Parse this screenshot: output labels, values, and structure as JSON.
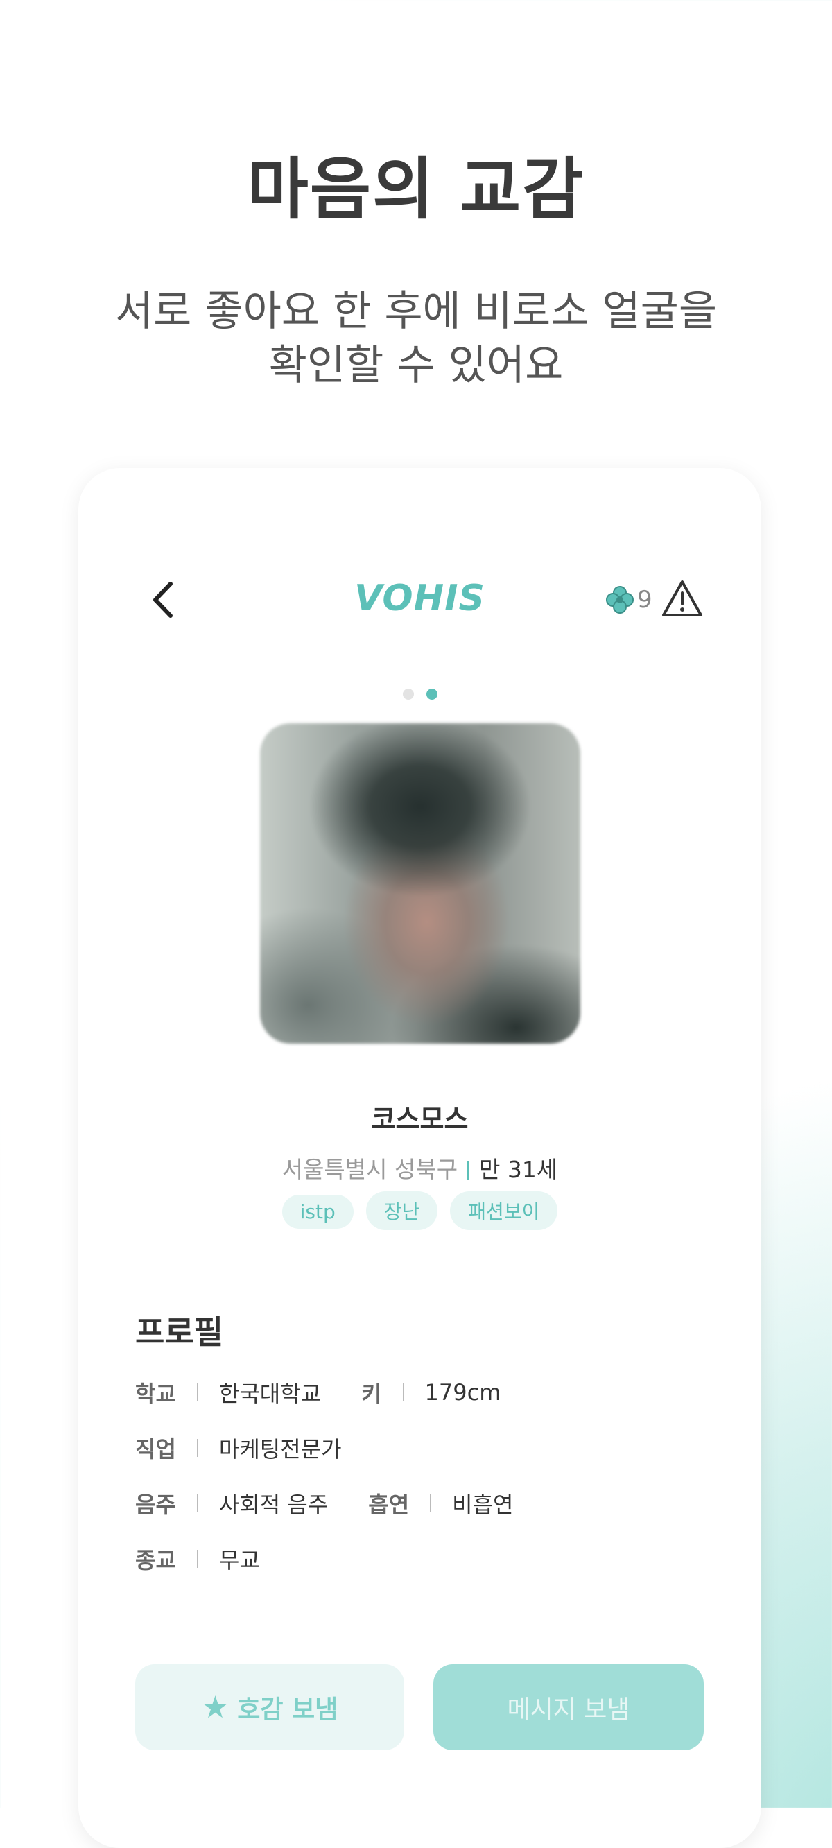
{
  "promo": {
    "headline": "마음의 교감",
    "subline_1": "서로 좋아요 한 후에 비로소 얼굴을",
    "subline_2": "확인할 수 있어요"
  },
  "app": {
    "brand": "VOHIS",
    "clover_count": "9",
    "accent_color": "#5cc0b8",
    "icons": [
      "chevron-left-icon",
      "clover-icon",
      "warning-icon",
      "star-icon"
    ]
  },
  "carousel": {
    "total": 2,
    "active_index": 1
  },
  "profile": {
    "name": "코스모스",
    "location": "서울특별시 성북구",
    "age": "만 31세",
    "tags": [
      "istp",
      "장난",
      "패션보이"
    ]
  },
  "details": {
    "title": "프로필",
    "school_label": "학교",
    "school_value": "한국대학교",
    "height_label": "키",
    "height_value": "179cm",
    "job_label": "직업",
    "job_value": "마케팅전문가",
    "drink_label": "음주",
    "drink_value": "사회적 음주",
    "smoke_label": "흡연",
    "smoke_value": "비흡연",
    "religion_label": "종교",
    "religion_value": "무교"
  },
  "actions": {
    "like_label": "호감 보냄",
    "message_label": "메시지 보냄"
  }
}
